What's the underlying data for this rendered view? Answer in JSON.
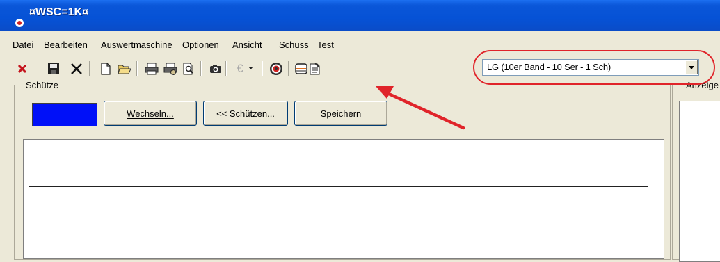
{
  "window": {
    "title": "¤WSC=1K¤"
  },
  "menu": [
    "Datei",
    "Bearbeiten",
    "Auswertmaschine",
    "Optionen",
    "Ansicht",
    "Schuss",
    "Test"
  ],
  "toolbar": {
    "euro_symbol": "€",
    "combo_value": "LG (10er Band - 10 Ser - 1 Sch)"
  },
  "shooter_group": {
    "label": "Schütze",
    "swatch_color": "#0010f8",
    "buttons": {
      "change": "Wechseln...",
      "shooters": "<< Schützen...",
      "save": "Speichern"
    }
  },
  "display_group": {
    "label": "Anzeige"
  },
  "annotation": {
    "color": "#e0242a"
  }
}
